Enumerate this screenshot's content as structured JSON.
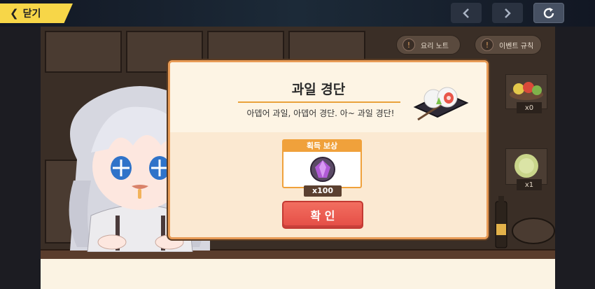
{
  "topbar": {
    "close_label": "닫기"
  },
  "kitchen": {
    "note_label": "요리 노트",
    "event_label": "이벤트 규칙",
    "items": [
      {
        "count": "x0",
        "icon": "fruit-bowl-icon"
      },
      {
        "count": "x1",
        "icon": "cabbage-icon"
      }
    ]
  },
  "dialog": {
    "title": "과일 경단",
    "description": "아뎁어 과일, 아뎁어 경단. 아~ 과일 경단!",
    "reward_header": "획득 보상",
    "reward_icon": "purple-crystal-icon",
    "reward_quantity": "x100",
    "confirm_label": "확 인"
  },
  "colors": {
    "accent_yellow": "#f7d648",
    "dialog_border": "#e79a55",
    "confirm_red": "#e44d45"
  }
}
